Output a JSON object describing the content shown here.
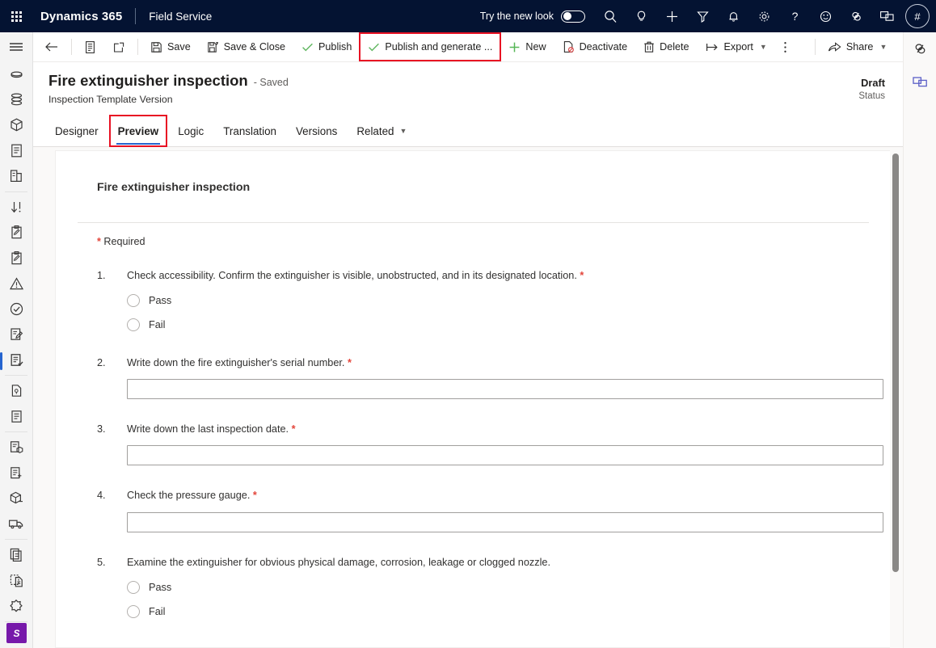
{
  "suite": {
    "waffle": "app-launcher",
    "brand": "Dynamics 365",
    "app_name": "Field Service",
    "new_look_label": "Try the new look",
    "new_look_on": false,
    "icons": [
      {
        "name": "search-icon",
        "glyph": "search"
      },
      {
        "name": "lightbulb-icon",
        "glyph": "lightbulb"
      },
      {
        "name": "add-icon",
        "glyph": "plus"
      },
      {
        "name": "filter-icon",
        "glyph": "funnel"
      },
      {
        "name": "notifications-bell-icon",
        "glyph": "bell"
      },
      {
        "name": "settings-gear-icon",
        "glyph": "gear"
      },
      {
        "name": "help-icon",
        "glyph": "question"
      },
      {
        "name": "feedback-smiley-icon",
        "glyph": "smiley"
      },
      {
        "name": "accessibility-icon",
        "glyph": "accessibility"
      },
      {
        "name": "copilot-chat-icon",
        "glyph": "chat"
      }
    ],
    "avatar_initial": "#",
    "bar_color": "#041332"
  },
  "rail": {
    "hamburger": "site-map-toggle",
    "items": [
      {
        "name": "sidebar-item-hamburger",
        "glyph": "hamburger",
        "selected": false
      },
      {
        "name": "sidebar-item-recent",
        "glyph": "disc",
        "selected": false
      },
      {
        "name": "sidebar-item-pinned",
        "glyph": "stack",
        "selected": false
      },
      {
        "name": "sidebar-item-assets",
        "glyph": "cube",
        "selected": false
      },
      {
        "name": "sidebar-item-agreements",
        "glyph": "document-list",
        "selected": false
      },
      {
        "name": "sidebar-item-buildings",
        "glyph": "building",
        "selected": false
      },
      {
        "name": "sidebar-item-transfer",
        "glyph": "arrow-down-alert",
        "selected": false
      },
      {
        "name": "sidebar-item-work-order",
        "glyph": "clipboard-pencil",
        "selected": false
      },
      {
        "name": "sidebar-item-work-order-2",
        "glyph": "clipboard-pencil",
        "selected": false
      },
      {
        "name": "sidebar-item-incidents",
        "glyph": "warning-triangle",
        "selected": false
      },
      {
        "name": "sidebar-item-completed",
        "glyph": "check-circle",
        "selected": false
      },
      {
        "name": "sidebar-item-inspection-edit",
        "glyph": "clipboard-edit",
        "selected": false
      },
      {
        "name": "sidebar-item-inspection-templates",
        "glyph": "form-check",
        "selected": true
      },
      {
        "name": "sidebar-item-quotes",
        "glyph": "document-badge",
        "selected": false
      },
      {
        "name": "sidebar-item-invoices",
        "glyph": "document-lines",
        "selected": false
      },
      {
        "name": "sidebar-item-purchase-orders",
        "glyph": "document-box",
        "selected": false
      },
      {
        "name": "sidebar-item-receipts",
        "glyph": "document-plus",
        "selected": false
      },
      {
        "name": "sidebar-item-products",
        "glyph": "box",
        "selected": false
      },
      {
        "name": "sidebar-item-shipments",
        "glyph": "truck",
        "selected": false
      },
      {
        "name": "sidebar-item-reports",
        "glyph": "documents",
        "selected": false
      },
      {
        "name": "sidebar-item-templates",
        "glyph": "document-dashed",
        "selected": false
      },
      {
        "name": "sidebar-item-settings",
        "glyph": "cog",
        "selected": false
      },
      {
        "name": "sidebar-item-copilot",
        "glyph": "chat-blue",
        "selected": false
      }
    ],
    "profile_initial": "S",
    "profile_color": "#7719aa",
    "selected_color": "#2564cf"
  },
  "command_bar": {
    "back": "back-arrow",
    "items": [
      {
        "name": "show-chart-button",
        "label": "",
        "icon": "report",
        "type": "icon"
      },
      {
        "name": "open-in-new-window-button",
        "label": "",
        "icon": "popout",
        "type": "icon"
      },
      {
        "name": "save-button",
        "label": "Save",
        "icon": "save",
        "type": "text"
      },
      {
        "name": "save-and-close-button",
        "label": "Save & Close",
        "icon": "save-close",
        "type": "text"
      },
      {
        "name": "publish-button",
        "label": "Publish",
        "icon": "check",
        "type": "text"
      },
      {
        "name": "publish-and-generate-button",
        "label": "Publish and generate ...",
        "icon": "check",
        "type": "text",
        "highlighted": true
      },
      {
        "name": "new-button",
        "label": "New",
        "icon": "plus",
        "type": "text"
      },
      {
        "name": "deactivate-button",
        "label": "Deactivate",
        "icon": "deactivate",
        "type": "text"
      },
      {
        "name": "delete-button",
        "label": "Delete",
        "icon": "trash",
        "type": "text"
      },
      {
        "name": "export-button",
        "label": "Export",
        "icon": "export",
        "type": "text",
        "chevron": true
      },
      {
        "name": "more-commands-button",
        "label": "",
        "icon": "kebab",
        "type": "icon"
      }
    ],
    "share": {
      "name": "share-button",
      "label": "Share",
      "icon": "share",
      "chevron": true
    },
    "highlight_color": "#e81123"
  },
  "record": {
    "title": "Fire extinguisher inspection",
    "saved_suffix": "- Saved",
    "subtitle": "Inspection Template Version",
    "status_value": "Draft",
    "status_label": "Status"
  },
  "tabs": {
    "items": [
      {
        "name": "tab-designer",
        "label": "Designer",
        "active": false,
        "chevron": false,
        "annotated": false
      },
      {
        "name": "tab-preview",
        "label": "Preview",
        "active": true,
        "chevron": false,
        "annotated": true
      },
      {
        "name": "tab-logic",
        "label": "Logic",
        "active": false,
        "chevron": false,
        "annotated": false
      },
      {
        "name": "tab-translation",
        "label": "Translation",
        "active": false,
        "chevron": false,
        "annotated": false
      },
      {
        "name": "tab-versions",
        "label": "Versions",
        "active": false,
        "chevron": false,
        "annotated": false
      },
      {
        "name": "tab-related",
        "label": "Related",
        "active": false,
        "chevron": true,
        "annotated": false
      }
    ]
  },
  "form": {
    "heading": "Fire extinguisher inspection",
    "required_note": "Required",
    "required_marker": "*",
    "questions": [
      {
        "number": "1.",
        "text": "Check accessibility. Confirm the extinguisher is visible, unobstructed, and in its designated location.",
        "required": true,
        "type": "radio",
        "options": [
          "Pass",
          "Fail"
        ]
      },
      {
        "number": "2.",
        "text": "Write down the fire extinguisher's serial number.",
        "required": true,
        "type": "text",
        "value": "",
        "placeholder": ""
      },
      {
        "number": "3.",
        "text": "Write down the last inspection date.",
        "required": true,
        "type": "text",
        "value": "",
        "placeholder": ""
      },
      {
        "number": "4.",
        "text": "Check the pressure gauge.",
        "required": true,
        "type": "text",
        "value": "",
        "placeholder": ""
      },
      {
        "number": "5.",
        "text": "Examine the extinguisher for obvious physical damage, corrosion, leakage or clogged nozzle.",
        "required": false,
        "type": "radio",
        "options": [
          "Pass",
          "Fail"
        ]
      }
    ]
  },
  "edge_rail": {
    "icons": [
      {
        "name": "accessibility-checker-icon",
        "glyph": "accessibility"
      },
      {
        "name": "copilot-panel-icon",
        "glyph": "chat-blue"
      }
    ]
  },
  "scrollbar": {
    "name": "preview-vertical-scrollbar"
  }
}
